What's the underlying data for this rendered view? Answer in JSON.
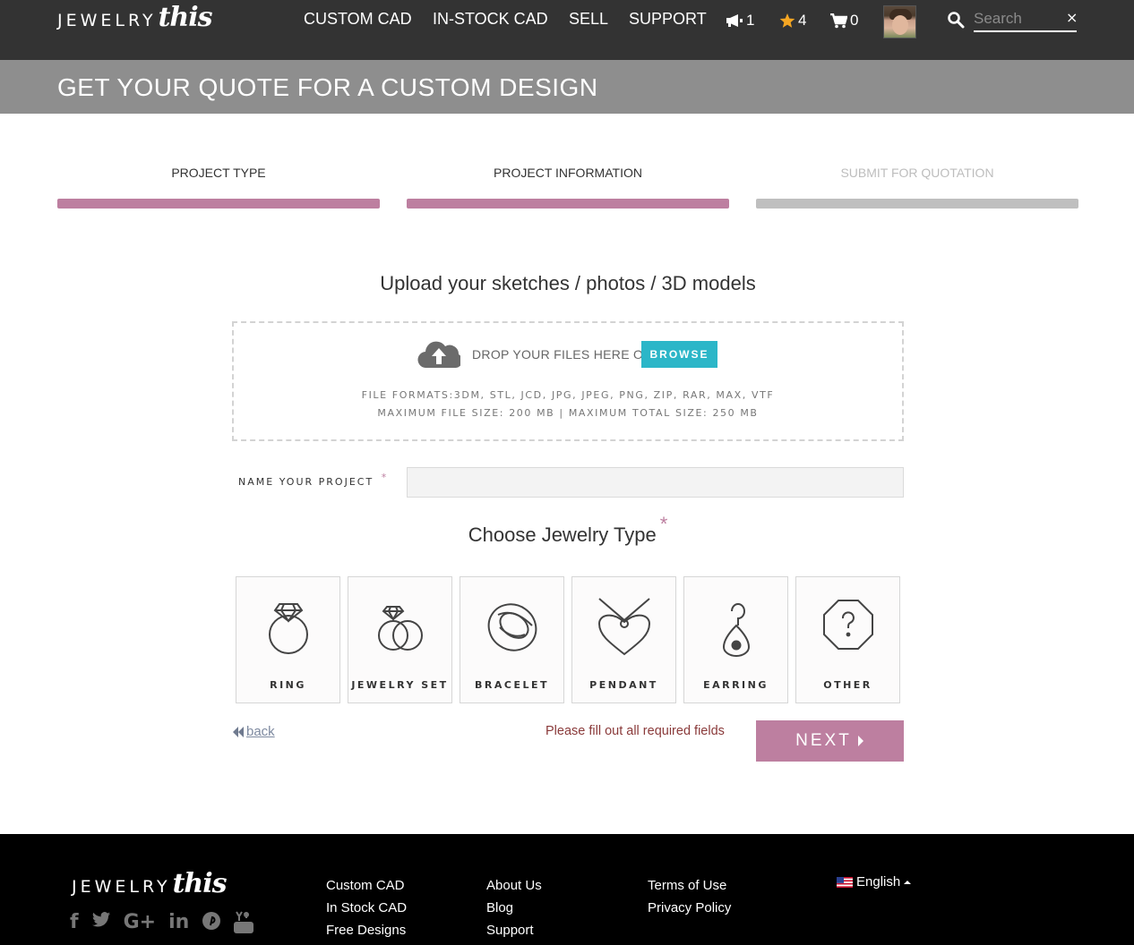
{
  "header": {
    "logo_word": "JEWELRY",
    "logo_script": "this",
    "nav": [
      "CUSTOM CAD",
      "IN-STOCK CAD",
      "SELL",
      "SUPPORT"
    ],
    "notifications_count": "1",
    "favorites_count": "4",
    "cart_count": "0",
    "search_placeholder": "Search",
    "search_clear": "×"
  },
  "title_band": {
    "title": "GET YOUR QUOTE FOR A CUSTOM DESIGN"
  },
  "steps": [
    {
      "label": "PROJECT TYPE",
      "state": "done"
    },
    {
      "label": "PROJECT INFORMATION",
      "state": "current"
    },
    {
      "label": "SUBMIT FOR QUOTATION",
      "state": "pending"
    }
  ],
  "upload": {
    "title": "Upload your sketches / photos / 3D models",
    "drop_text": "DROP YOUR FILES HERE OR",
    "browse_label": "BROWSE",
    "formats": "FILE FORMATS:3DM, STL, JCD, JPG, JPEG, PNG, ZIP, RAR, MAX, VTF",
    "limits": "MAXIMUM FILE SIZE: 200 MB | MAXIMUM TOTAL SIZE: 250 MB"
  },
  "project_name": {
    "label": "NAME YOUR PROJECT",
    "required_mark": "*",
    "value": ""
  },
  "jewelry_type": {
    "title": "Choose Jewelry Type",
    "required_mark": "*",
    "options": [
      "RING",
      "JEWELRY SET",
      "BRACELET",
      "PENDANT",
      "EARRING",
      "OTHER"
    ]
  },
  "actions": {
    "back_label": "back",
    "warning": "Please fill out all required fields",
    "next_label": "NEXT"
  },
  "footer": {
    "col1": [
      "Custom CAD",
      "In Stock CAD",
      "Free Designs"
    ],
    "col2": [
      "About Us",
      "Blog",
      "Support"
    ],
    "col3": [
      "Terms of Use",
      "Privacy Policy"
    ],
    "language": "English",
    "social": [
      "facebook-icon",
      "twitter-icon",
      "google-plus-icon",
      "linkedin-icon",
      "pinterest-icon",
      "youtube-icon"
    ]
  },
  "colors": {
    "header_bg": "#333333",
    "band_bg": "#8e8e8e",
    "accent": "#bd7fa0",
    "browse": "#2bb6c8",
    "footer_bg": "#000000"
  }
}
